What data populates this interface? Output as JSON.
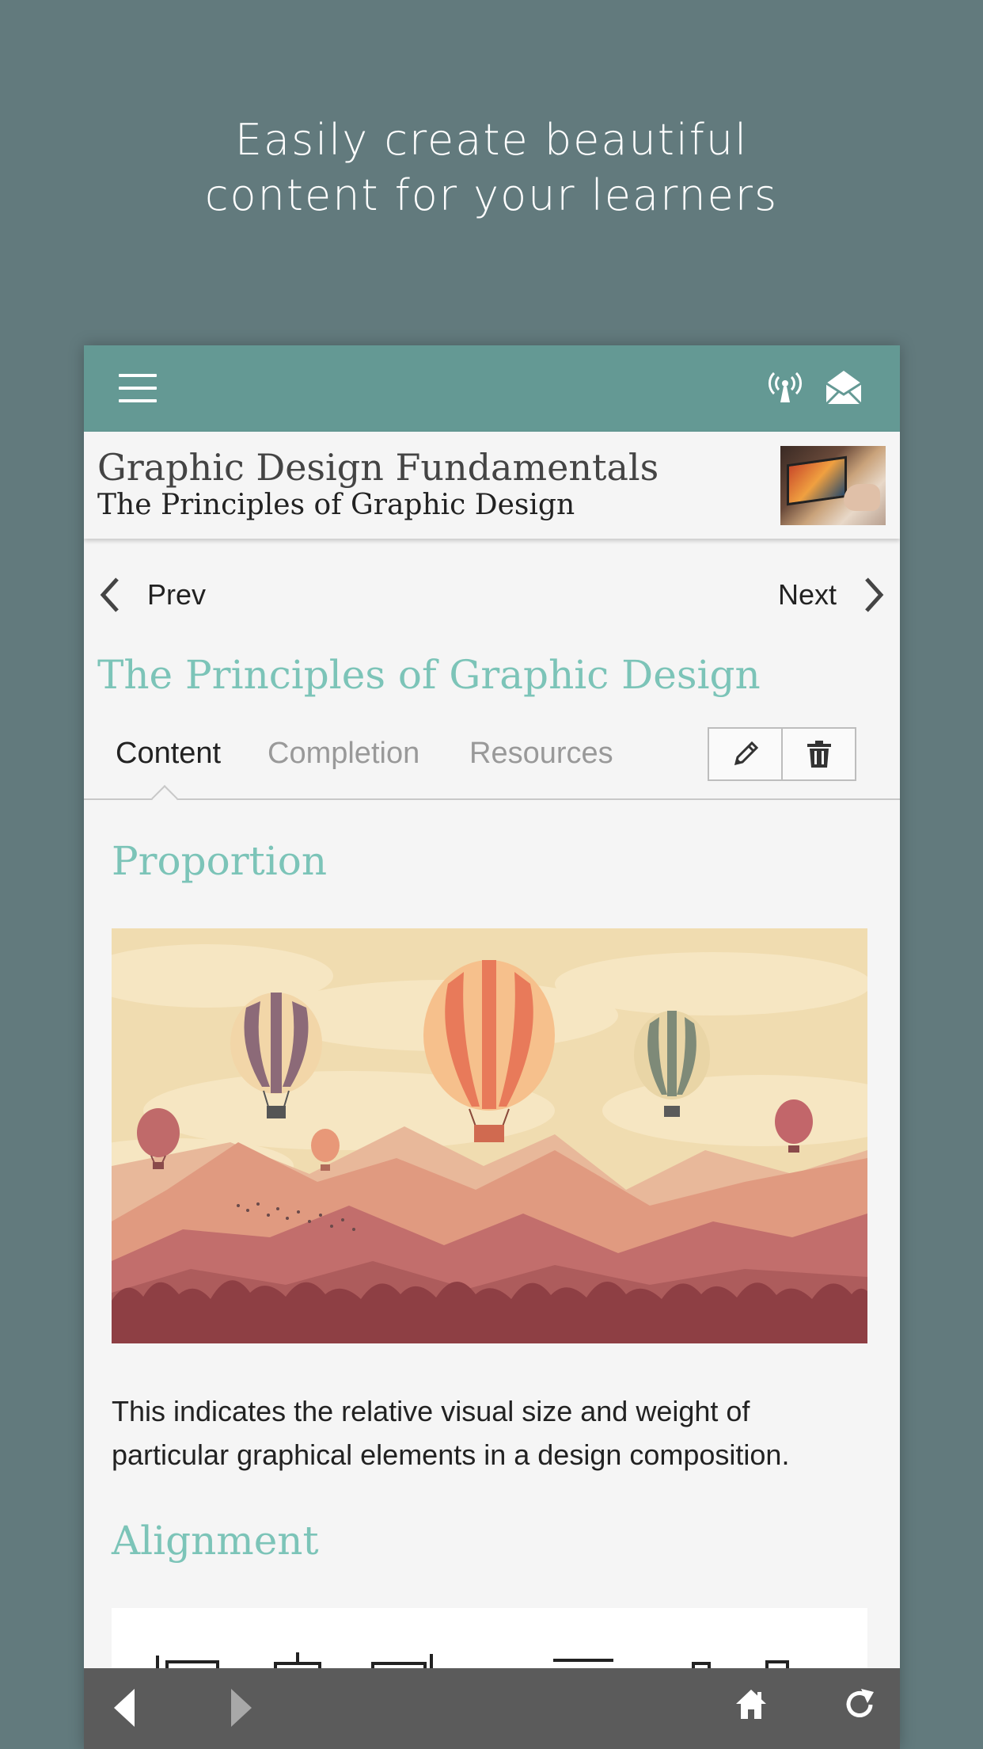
{
  "hero": {
    "line1": "Easily create beautiful",
    "line2": "content for your learners"
  },
  "appbar": {
    "menu_icon": "hamburger-menu-icon",
    "broadcast_icon": "broadcast-icon",
    "mail_icon": "mail-icon",
    "color": "#649994"
  },
  "course": {
    "title": "Graphic Design Fundamentals",
    "subtitle": "The Principles of Graphic Design"
  },
  "nav": {
    "prev_label": "Prev",
    "next_label": "Next"
  },
  "lesson": {
    "title": "The Principles of Graphic Design"
  },
  "tabs": [
    {
      "label": "Content",
      "active": true
    },
    {
      "label": "Completion",
      "active": false
    },
    {
      "label": "Resources",
      "active": false
    }
  ],
  "tools": {
    "edit_icon": "pencil-icon",
    "delete_icon": "trash-icon"
  },
  "sections": [
    {
      "heading": "Proportion",
      "body": "This indicates the relative visual size and weight of particular graphical elements in a design composition."
    },
    {
      "heading": "Alignment"
    }
  ],
  "bottombar": {
    "back_icon": "back-arrow-icon",
    "forward_icon": "forward-arrow-icon",
    "home_icon": "home-icon",
    "refresh_icon": "refresh-icon"
  },
  "colors": {
    "background": "#627a7d",
    "accent": "#7cc4b8",
    "bottombar": "#5b5b5b"
  }
}
